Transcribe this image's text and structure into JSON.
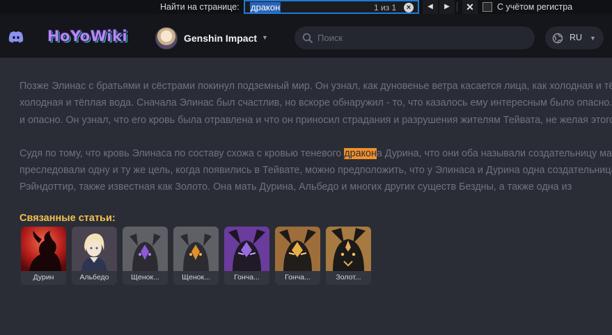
{
  "find_bar": {
    "label": "Найти на странице:",
    "query": "дракон",
    "count": "1 из 1",
    "match_case_label": "С учётом регистра"
  },
  "header": {
    "logo": "HoYoWiki",
    "game_name": "Genshin Impact",
    "search_placeholder": "Поиск",
    "language": "RU"
  },
  "article": {
    "paragraph1": [
      "Позже Элинас с братьями и сёстрами покинул подземный мир. Он узнал, как дуновенье ветра касается лица, как холодная и тёплая вода.",
      "холодная и тёплая вода. Сначала Элинас был счастлив, но вскоре обнаружил - то, что казалось ему интересным было опасно.",
      "и опасно. Он узнал, что его кровь была отравлена и что он приносил страдания и разрушения жителям Тейвата, не желая этого."
    ],
    "paragraph2_line1_before": "Судя по тому, что кровь Элинаса по составу схожа с кровью теневого ",
    "paragraph2_highlight": "дракон",
    "paragraph2_line1_after": "а Дурина, что они оба называли создательницу матерью,",
    "paragraph2_rest": [
      "преследовали одну и ту же цель, когда появились в Тейвате, можно предположить, что у Элинаса и Дурина одна создательница -",
      "Рэйндоттир, также известная как Золото. Она мать Дурина, Альбедо и многих других существ Бездны, а также одна из"
    ]
  },
  "related": {
    "title": "Связанные статьи:",
    "items": [
      {
        "label": "Дурин",
        "icon": "durin-icon"
      },
      {
        "label": "Альбедо",
        "icon": "albedo-icon"
      },
      {
        "label": "Щенок...",
        "icon": "hound-pup-purple-icon"
      },
      {
        "label": "Щенок...",
        "icon": "hound-pup-orange-icon"
      },
      {
        "label": "Гонча...",
        "icon": "hound-purple-icon"
      },
      {
        "label": "Гонча...",
        "icon": "hound-gold-icon"
      },
      {
        "label": "Золот...",
        "icon": "golden-wolflord-icon"
      }
    ]
  },
  "colors": {
    "background": "#2a2d36",
    "header": "#14161b",
    "highlight": "#f0902c",
    "related_title": "#f3c24d",
    "find_focus": "#1f7ad8"
  }
}
